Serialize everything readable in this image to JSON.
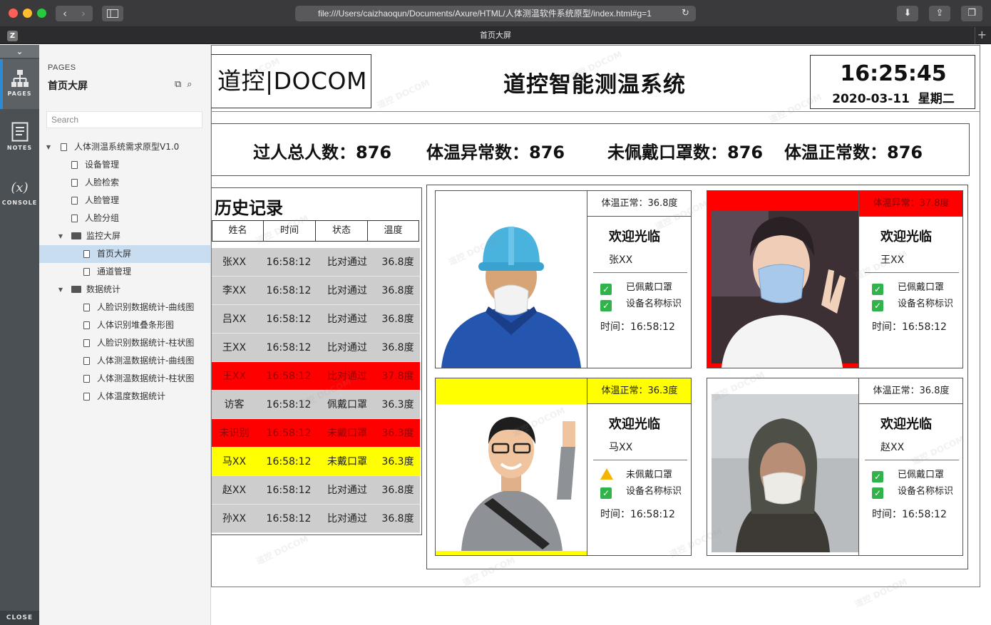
{
  "browser": {
    "url": "file:///Users/caizhaoqun/Documents/Axure/HTML/人体测温软件系统原型/index.html#g=1",
    "tab_title": "首页大屏",
    "tab_badge": "Z"
  },
  "axure_rail": {
    "pages_label": "PAGES",
    "notes_label": "NOTES",
    "console_label": "CONSOLE",
    "console_symbol": "(x)",
    "close_label": "CLOSE"
  },
  "pages_panel": {
    "heading": "PAGES",
    "current_page": "首页大屏",
    "search_placeholder": "Search",
    "tree": [
      {
        "label": "人体测温系统需求原型V1.0",
        "level": 0,
        "type": "page",
        "expanded": true
      },
      {
        "label": "设备管理",
        "level": 1,
        "type": "page"
      },
      {
        "label": "人脸检索",
        "level": 1,
        "type": "page"
      },
      {
        "label": "人脸管理",
        "level": 1,
        "type": "page"
      },
      {
        "label": "人脸分组",
        "level": 1,
        "type": "page"
      },
      {
        "label": "监控大屏",
        "level": 1,
        "type": "folder",
        "expanded": true
      },
      {
        "label": "首页大屏",
        "level": 2,
        "type": "page",
        "selected": true
      },
      {
        "label": "通道管理",
        "level": 2,
        "type": "page"
      },
      {
        "label": "数据统计",
        "level": 1,
        "type": "folder",
        "expanded": true
      },
      {
        "label": "人脸识别数据统计-曲线图",
        "level": 2,
        "type": "page"
      },
      {
        "label": "人体识别堆叠条形图",
        "level": 2,
        "type": "page"
      },
      {
        "label": "人脸识别数据统计-柱状图",
        "level": 2,
        "type": "page"
      },
      {
        "label": "人体测温数据统计-曲线图",
        "level": 2,
        "type": "page"
      },
      {
        "label": "人体测温数据统计-柱状图",
        "level": 2,
        "type": "page"
      },
      {
        "label": "人体温度数据统计",
        "level": 2,
        "type": "page"
      }
    ]
  },
  "screen": {
    "logo": "道控|DOCOM",
    "title": "道控智能测温系统",
    "clock_time": "16:25:45",
    "clock_date": "2020-03-11  星期二",
    "watermark": "道控 DOCOM",
    "stats": [
      {
        "label": "过人总人数：876"
      },
      {
        "label": "体温异常数：876"
      },
      {
        "label": "未佩戴口罩数：876"
      },
      {
        "label": "体温正常数：876"
      }
    ],
    "history": {
      "title": "历史记录",
      "headers": [
        "姓名",
        "时间",
        "状态",
        "温度"
      ],
      "rows": [
        {
          "name": "张XX",
          "time": "16:58:12",
          "status": "比对通过",
          "temp": "36.8度",
          "style": "normal"
        },
        {
          "name": "李XX",
          "time": "16:58:12",
          "status": "比对通过",
          "temp": "36.8度",
          "style": "normal"
        },
        {
          "name": "吕XX",
          "time": "16:58:12",
          "status": "比对通过",
          "temp": "36.8度",
          "style": "normal"
        },
        {
          "name": "王XX",
          "time": "16:58:12",
          "status": "比对通过",
          "temp": "36.8度",
          "style": "normal"
        },
        {
          "name": "王XX",
          "time": "16:58:12",
          "status": "比对通过",
          "temp": "37.8度",
          "style": "red"
        },
        {
          "name": "访客",
          "time": "16:58:12",
          "status": "佩戴口罩",
          "temp": "36.3度",
          "style": "normal"
        },
        {
          "name": "未识别",
          "time": "16:58:12",
          "status": "未戴口罩",
          "temp": "36.3度",
          "style": "red"
        },
        {
          "name": "马XX",
          "time": "16:58:12",
          "status": "未戴口罩",
          "temp": "36.3度",
          "style": "yellow"
        },
        {
          "name": "赵XX",
          "time": "16:58:12",
          "status": "比对通过",
          "temp": "36.8度",
          "style": "normal"
        },
        {
          "name": "孙XX",
          "time": "16:58:12",
          "status": "比对通过",
          "temp": "36.8度",
          "style": "normal"
        }
      ]
    },
    "cards": [
      {
        "temp_label": "体温正常：36.8度",
        "temp_style": "normal",
        "welcome": "欢迎光临",
        "name": "张XX",
        "checks": [
          {
            "icon": "check",
            "text": "已佩戴口罩"
          },
          {
            "icon": "check",
            "text": "设备名称标识"
          }
        ],
        "time": "时间：16:58:12",
        "photo": "worker-with-helmet",
        "frame": "normal"
      },
      {
        "temp_label": "体温异常：37.8度",
        "temp_style": "red",
        "welcome": "欢迎光临",
        "name": "王XX",
        "checks": [
          {
            "icon": "check",
            "text": "已佩戴口罩"
          },
          {
            "icon": "check",
            "text": "设备名称标识"
          }
        ],
        "time": "时间：16:58:12",
        "photo": "young-man-mask",
        "frame": "red"
      },
      {
        "temp_label": "体温正常：36.3度",
        "temp_style": "yellow",
        "welcome": "欢迎光临",
        "name": "马XX",
        "checks": [
          {
            "icon": "warning",
            "text": "未佩戴口罩"
          },
          {
            "icon": "check",
            "text": "设备名称标识"
          }
        ],
        "time": "时间：16:58:12",
        "photo": "smiling-man-glasses",
        "frame": "yellow"
      },
      {
        "temp_label": "体温正常：36.8度",
        "temp_style": "normal",
        "welcome": "欢迎光临",
        "name": "赵XX",
        "checks": [
          {
            "icon": "check",
            "text": "已佩戴口罩"
          },
          {
            "icon": "check",
            "text": "设备名称标识"
          }
        ],
        "time": "时间：16:58:12",
        "photo": "elderly-woman-mask",
        "frame": "normal"
      }
    ]
  },
  "colors": {
    "alarm_red": "#ff0000",
    "warn_yellow": "#ffff00",
    "row_gray": "#cdcdcd",
    "check_green": "#2fb34a",
    "selected_page": "#c8ddf0"
  }
}
